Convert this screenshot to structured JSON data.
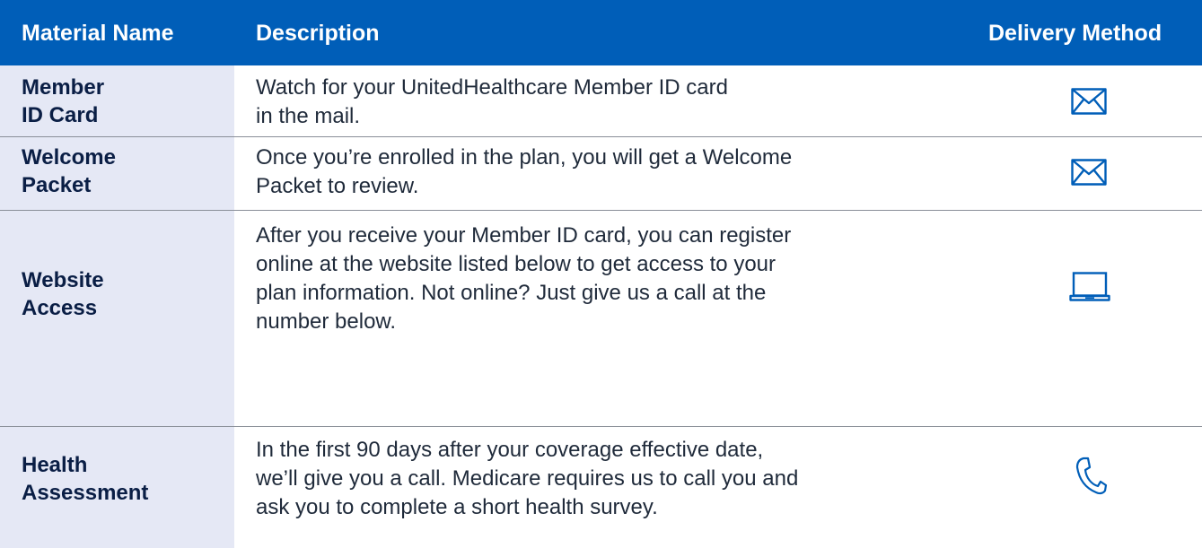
{
  "header": {
    "material_name": "Material Name",
    "description": "Description",
    "delivery_method": "Delivery Method"
  },
  "rows": [
    {
      "name_line1": "Member",
      "name_line2": "ID Card",
      "desc_lines": [
        "Watch for your UnitedHealthcare Member ID card",
        "in the mail."
      ],
      "delivery_icon": "mail-icon"
    },
    {
      "name_line1": "Welcome",
      "name_line2": "Packet",
      "desc_lines": [
        "Once you’re enrolled in the plan, you will get a Welcome",
        "Packet to review."
      ],
      "delivery_icon": "mail-icon"
    },
    {
      "name_line1": "Website",
      "name_line2": "Access",
      "desc_lines": [
        "After you receive your Member ID card, you can register",
        "online at the website listed below to get access to your",
        "plan information. Not online? Just give us a call at the",
        "number below."
      ],
      "delivery_icon": "laptop-icon"
    },
    {
      "name_line1": "Health",
      "name_line2": "Assessment",
      "desc_lines": [
        "In the first 90 days after your coverage effective date,",
        "we’ll give you a call. Medicare requires us to call you and",
        "ask you to complete a short health survey."
      ],
      "delivery_icon": "phone-icon"
    }
  ],
  "colors": {
    "header_bg": "#005eb8",
    "name_column_bg": "#e5e8f5",
    "icon_blue": "#005eb8",
    "divider": "#8a8f98"
  }
}
